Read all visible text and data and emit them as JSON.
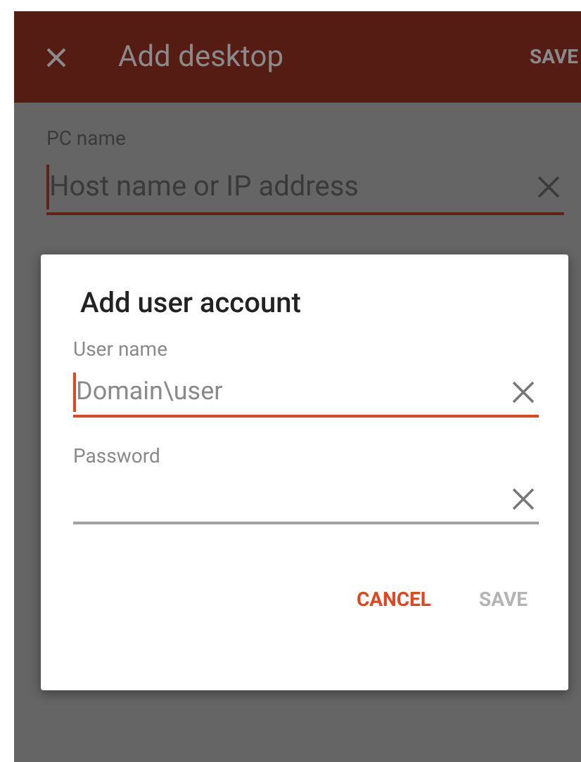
{
  "app_bar": {
    "title": "Add desktop",
    "action": "SAVE"
  },
  "form": {
    "label": "PC name",
    "field": {
      "placeholder": "Host name or IP address",
      "focused": true
    }
  },
  "dialog": {
    "title": "Add user account",
    "fields": [
      {
        "label": "User name",
        "placeholder": "Domain\\user",
        "focused": true
      },
      {
        "label": "Password",
        "focused": false
      }
    ],
    "buttons": [
      {
        "label": "CANCEL",
        "disabled": false
      },
      {
        "label": "SAVE",
        "disabled": true
      }
    ]
  }
}
